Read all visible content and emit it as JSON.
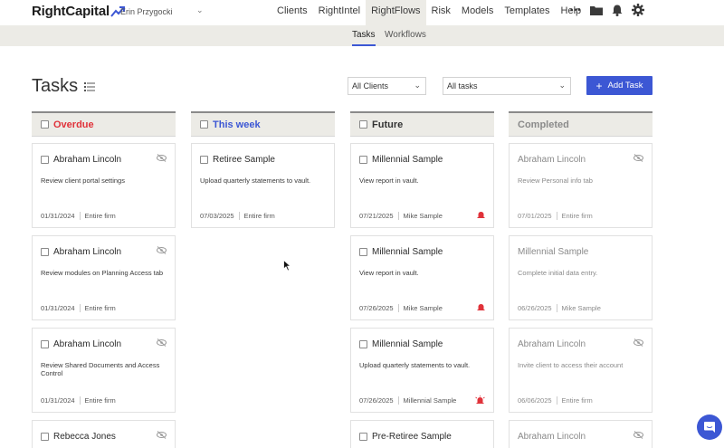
{
  "app": {
    "logo": "RightCapital",
    "user": "Erin Przygocki"
  },
  "nav": {
    "items": [
      "Clients",
      "RightIntel",
      "RightFlows",
      "Risk",
      "Models",
      "Templates",
      "Help"
    ],
    "active": "RightFlows",
    "more": "•••"
  },
  "subnav": {
    "tabs": [
      "Tasks",
      "Workflows"
    ],
    "active": "Tasks"
  },
  "page": {
    "title": "Tasks"
  },
  "filters": {
    "client_filter": "All Clients",
    "task_filter": "All tasks"
  },
  "toolbar": {
    "add_task": "Add Task"
  },
  "colors": {
    "accent": "#3c57d4",
    "overdue": "#e0323a",
    "this_week": "#3c57d4",
    "header_bg": "#ecebe6"
  },
  "columns": [
    {
      "title": "Overdue",
      "cards": [
        {
          "client": "Abraham Lincoln",
          "desc": "Review client portal settings",
          "date": "01/31/2024",
          "assignee": "Entire firm"
        },
        {
          "client": "Abraham Lincoln",
          "desc": "Review modules on Planning Access tab",
          "date": "01/31/2024",
          "assignee": "Entire firm"
        },
        {
          "client": "Abraham Lincoln",
          "desc": "Review Shared Documents and Access Control",
          "date": "01/31/2024",
          "assignee": "Entire firm"
        },
        {
          "client": "Rebecca Jones",
          "desc": "",
          "date": "",
          "assignee": ""
        }
      ]
    },
    {
      "title": "This week",
      "cards": [
        {
          "client": "Retiree Sample",
          "desc": "Upload quarterly statements to vault.",
          "date": "07/03/2025",
          "assignee": "Entire firm"
        }
      ]
    },
    {
      "title": "Future",
      "cards": [
        {
          "client": "Millennial Sample",
          "desc": "View report in vault.",
          "date": "07/21/2025",
          "assignee": "Mike Sample"
        },
        {
          "client": "Millennial Sample",
          "desc": "View report in vault.",
          "date": "07/26/2025",
          "assignee": "Mike Sample"
        },
        {
          "client": "Millennial Sample",
          "desc": "Upload quarterly statements to vault.",
          "date": "07/26/2025",
          "assignee": "Millennial Sample"
        },
        {
          "client": "Pre-Retiree Sample",
          "desc": "",
          "date": "",
          "assignee": ""
        }
      ]
    },
    {
      "title": "Completed",
      "cards": [
        {
          "client": "Abraham Lincoln",
          "desc": "Review Personal info tab",
          "date": "07/01/2025",
          "assignee": "Entire firm"
        },
        {
          "client": "Millennial Sample",
          "desc": "Complete initial data entry.",
          "date": "06/26/2025",
          "assignee": "Mike Sample"
        },
        {
          "client": "Abraham Lincoln",
          "desc": "Invite client to access their account",
          "date": "06/06/2025",
          "assignee": "Entire firm"
        },
        {
          "client": "Abraham Lincoln",
          "desc": "",
          "date": "",
          "assignee": ""
        }
      ]
    }
  ]
}
